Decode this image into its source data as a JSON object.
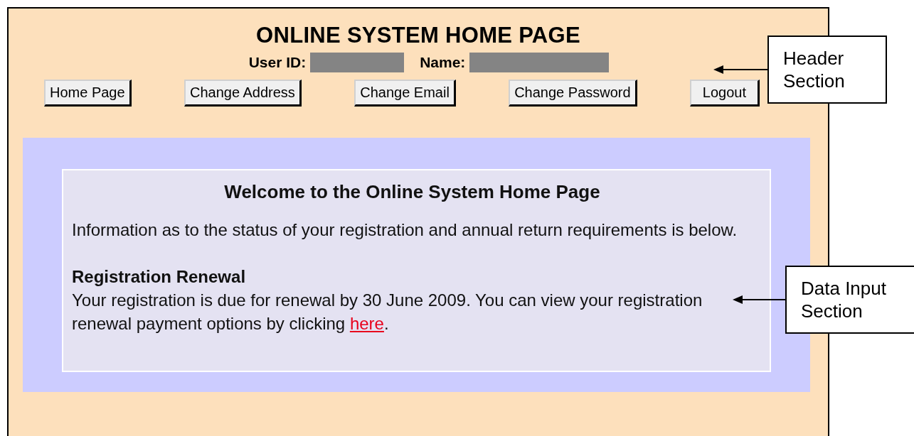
{
  "header": {
    "title": "ONLINE SYSTEM HOME PAGE",
    "user_id_label": "User ID:",
    "name_label": "Name:",
    "buttons": [
      "Home Page",
      "Change Address",
      "Change Email",
      "Change Password",
      "Logout"
    ]
  },
  "content": {
    "heading": "Welcome to the Online System Home Page",
    "intro": "Information as to the status of your registration and annual return requirements is below.",
    "section_title": "Registration Renewal",
    "section_text": "Your registration is due for renewal by 30 June 2009. You can view your registration renewal payment options by clicking ",
    "link": "here",
    "section_end": "."
  },
  "callouts": [
    {
      "label": "Header Section"
    },
    {
      "label": "Data Input Section"
    }
  ]
}
